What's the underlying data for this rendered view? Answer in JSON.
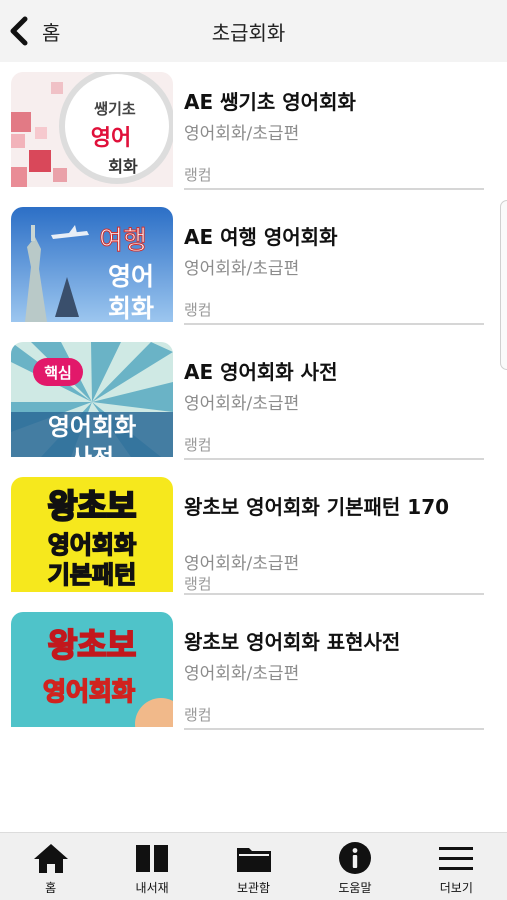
{
  "header": {
    "back_label": "홈",
    "title": "초급회화",
    "back_icon": "chevron-left-icon"
  },
  "items": [
    {
      "title": "AE 쌩기초 영어회화",
      "subtitle": "영어회화/초급편",
      "publisher": "랭컴",
      "thumb": {
        "line1": "쌩기초",
        "line2": "영어",
        "line3": "회화"
      }
    },
    {
      "title": "AE 여행 영어회화",
      "subtitle": "영어회화/초급편",
      "publisher": "랭컴",
      "thumb": {
        "line1": "여행",
        "line2": "영어",
        "line3": "회화"
      }
    },
    {
      "title": "AE 영어회화 사전",
      "subtitle": "영어회화/초급편",
      "publisher": "랭컴",
      "thumb": {
        "badge": "핵심",
        "line1": "영어회화",
        "line2": "사전"
      }
    },
    {
      "title": "왕초보 영어회화 기본패턴 170",
      "subtitle": "영어회화/초급편",
      "publisher": "랭컴",
      "thumb": {
        "line1": "왕초보",
        "line2": "영어회화",
        "line3": "기본패턴"
      }
    },
    {
      "title": "왕초보 영어회화 표현사전",
      "subtitle": "영어회화/초급편",
      "publisher": "랭컴",
      "thumb": {
        "line1": "왕초보",
        "line2": "영어회화"
      }
    }
  ],
  "tabs": [
    {
      "label": "홈",
      "icon": "home-icon"
    },
    {
      "label": "내서재",
      "icon": "book-icon"
    },
    {
      "label": "보관함",
      "icon": "folder-icon"
    },
    {
      "label": "도움말",
      "icon": "info-icon"
    },
    {
      "label": "더보기",
      "icon": "menu-icon"
    }
  ],
  "colors": {
    "header_bg": "#f3f3f3",
    "subtitle": "#8c8c8c",
    "divider": "#d6d6d6",
    "tabbar_bg": "#f0f0f0"
  }
}
